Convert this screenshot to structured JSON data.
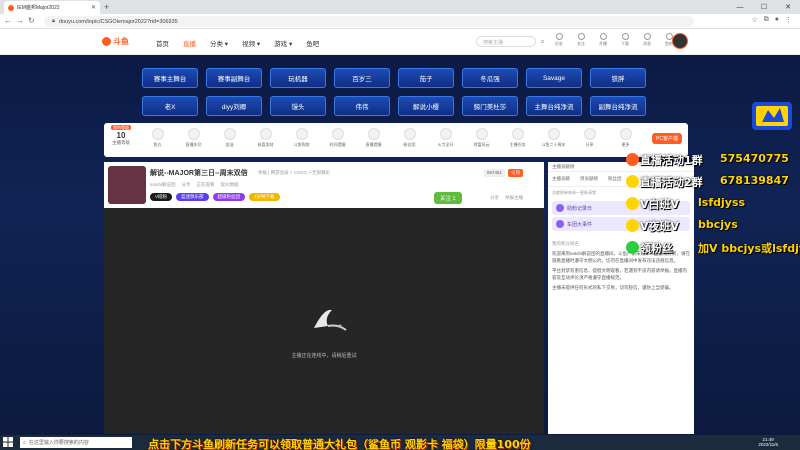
{
  "browser": {
    "tab_title": "IEM盛邦Major2022",
    "url_host": "douyu.com",
    "url_path": "/topic/CSGOiemajor2022?rid=306935"
  },
  "header": {
    "nav": [
      "首页",
      "直播",
      "分类",
      "视频",
      "游戏",
      "鱼吧"
    ],
    "search_placeholder": "搜索主播",
    "icons": [
      "历史",
      "关注",
      "开播",
      "下载",
      "消息",
      "鱼吧"
    ]
  },
  "player_buttons": [
    "赛事主舞台",
    "赛事副舞台",
    "玩机器",
    "百岁三",
    "茄子",
    "冬瓜强",
    "Savage",
    "铁胖",
    "老X",
    "diyy刘卿",
    "馒头",
    "伟伟",
    "解说小樱",
    "鲸门美杜莎",
    "主舞台纯净流",
    "副舞台纯净流"
  ],
  "tasks": {
    "level_badge": "我的等级",
    "level_num": "10",
    "level_label": "主播等级",
    "items": [
      "鱼丸",
      "直播庆功",
      "加油",
      "恭喜发财",
      "斗鱼购物",
      "时间提醒",
      "直播提醒",
      "粉丝团",
      "火力全开",
      "财富风云",
      "主播任务",
      "斗鱼二十周年",
      "分享",
      "更多"
    ],
    "pc_button": "PC客户端"
  },
  "stream": {
    "title": "解说--MAJOR第三日--周末双倍",
    "meta": "举报  | 网游竞技 > CSGO > 无限精彩",
    "owner": "satohi解说团",
    "row2": [
      "分享",
      "正在观看",
      "观众数据"
    ],
    "chips": [
      {
        "text": "V班粉",
        "color": "#1a1a1a"
      },
      {
        "text": "蓝迷俱乐部",
        "color": "#5c3cf0"
      },
      {
        "text": "超级粉丝团",
        "color": "#8e3cf0"
      },
      {
        "text": "1分钟下载",
        "color": "#f0b800"
      }
    ],
    "follow": "关注",
    "follow_count": "1",
    "share": "分享",
    "report": "举报主播",
    "viewers_count": "697461",
    "hot_label": "火热",
    "loading_text": "主播正在连线中，请稍后重试"
  },
  "chat": {
    "header": "主播贡献榜",
    "tabs": [
      "主播贡献",
      "周贡献榜",
      "粉丝团"
    ],
    "note": "贡献榜单每周一更新清零",
    "promos": [
      "助粉记录日",
      "车团大事件"
    ],
    "rank_row": "我的积分排名",
    "messages": [
      "欢迎来到satohi解说团的直播间，斗鱼严禁未成年人直播或打赏，请在观看直播时遵守文明公约，切勿在直播间中发布违法违规信息。",
      "平台封禁有害信息，提倡文明观看，若遇到不良内容请举报。直播内容及互动评论须严格遵守直播规范。",
      "主播未提供任何形式的私下交易，切勿轻信，谨防上当受骗。"
    ]
  },
  "overlay": {
    "lines": [
      {
        "label": "直播活动1群",
        "value": "575470775"
      },
      {
        "label": "直播活动2群",
        "value": "678139847"
      },
      {
        "label": "V白班V",
        "value": "lsfdjyss"
      },
      {
        "label": "V夜班V",
        "value": "bbcjys"
      },
      {
        "label": "领粉丝",
        "value": "加V bbcjys或lsfdjys"
      }
    ]
  },
  "os": {
    "search_placeholder": "在这里输入你要搜索的内容",
    "marquee": "点击下方斗鱼刷新任务可以领取普通大礼包（鲨鱼币 观影卡 福袋）限量100份",
    "time": "21:49",
    "date": "2022/11/6"
  },
  "colors": {
    "brand": "#ff5d23",
    "button_bg": "#1e4bb4",
    "overlay_value": "#ffd400"
  }
}
